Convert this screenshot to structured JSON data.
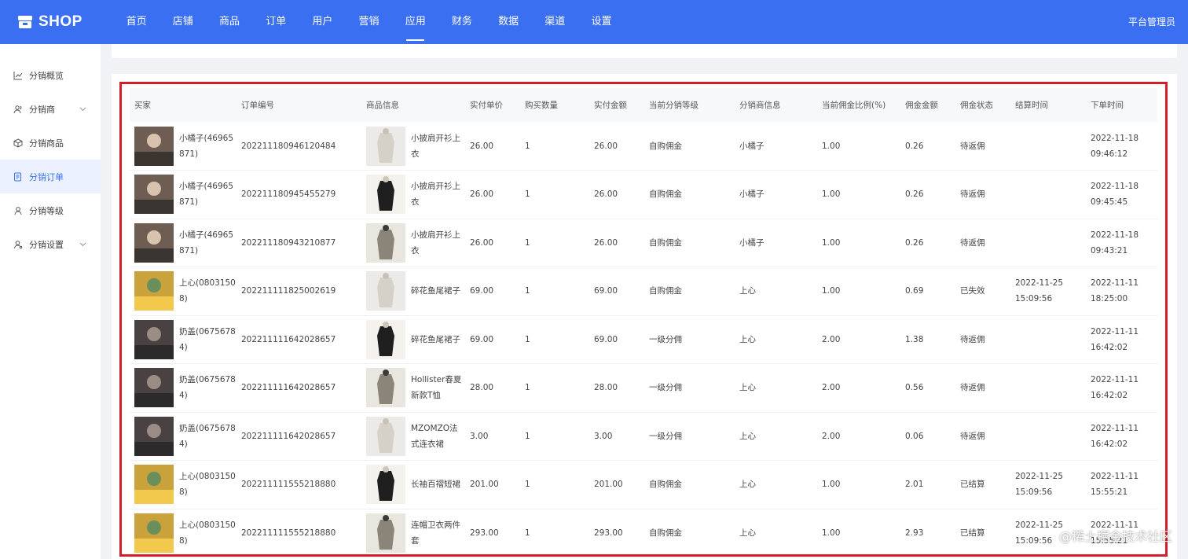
{
  "brand": {
    "name": "SHOP"
  },
  "nav": {
    "items": [
      "首页",
      "店铺",
      "商品",
      "订单",
      "用户",
      "营销",
      "应用",
      "财务",
      "数据",
      "渠道",
      "设置"
    ],
    "active": "应用"
  },
  "user": {
    "role": "平台管理员"
  },
  "sidebar": {
    "items": [
      {
        "label": "分销概览",
        "icon": "chart-line-icon"
      },
      {
        "label": "分销商",
        "icon": "users-icon",
        "expandable": true
      },
      {
        "label": "分销商品",
        "icon": "box-icon"
      },
      {
        "label": "分销订单",
        "icon": "order-icon",
        "active": true
      },
      {
        "label": "分销等级",
        "icon": "user-level-icon"
      },
      {
        "label": "分销设置",
        "icon": "user-settings-icon",
        "expandable": true
      }
    ]
  },
  "table": {
    "headers": [
      "买家",
      "订单编号",
      "商品信息",
      "实付单价",
      "购买数量",
      "实付金额",
      "当前分销等级",
      "分销商信息",
      "当前佣金比例(%)",
      "佣金金额",
      "佣金状态",
      "结算时间",
      "下单时间"
    ],
    "rows": [
      {
        "buyer": "小橘子(46965871)",
        "order_no": "202211180946120484",
        "goods": "小披肩开衫上衣",
        "unit_price": "26.00",
        "qty": "1",
        "amount": "26.00",
        "level": "自购佣金",
        "distributor": "小橘子",
        "ratio": "1.00",
        "commission": "0.26",
        "status": "待返佣",
        "settle_time": "",
        "order_time": "2022-11-18 09:46:12"
      },
      {
        "buyer": "小橘子(46965871)",
        "order_no": "202211180945455279",
        "goods": "小披肩开衫上衣",
        "unit_price": "26.00",
        "qty": "1",
        "amount": "26.00",
        "level": "自购佣金",
        "distributor": "小橘子",
        "ratio": "1.00",
        "commission": "0.26",
        "status": "待返佣",
        "settle_time": "",
        "order_time": "2022-11-18 09:45:45"
      },
      {
        "buyer": "小橘子(46965871)",
        "order_no": "202211180943210877",
        "goods": "小披肩开衫上衣",
        "unit_price": "26.00",
        "qty": "1",
        "amount": "26.00",
        "level": "自购佣金",
        "distributor": "小橘子",
        "ratio": "1.00",
        "commission": "0.26",
        "status": "待返佣",
        "settle_time": "",
        "order_time": "2022-11-18 09:43:21"
      },
      {
        "buyer": "上心(08031508)",
        "order_no": "202211111825002619",
        "goods": "碎花鱼尾裙子",
        "unit_price": "69.00",
        "qty": "1",
        "amount": "69.00",
        "level": "自购佣金",
        "distributor": "上心",
        "ratio": "1.00",
        "commission": "0.69",
        "status": "已失效",
        "settle_time": "2022-11-25 15:09:56",
        "order_time": "2022-11-11 18:25:00"
      },
      {
        "buyer": "奶盖(06756784)",
        "order_no": "202211111642028657",
        "goods": "碎花鱼尾裙子",
        "unit_price": "69.00",
        "qty": "1",
        "amount": "69.00",
        "level": "一级分佣",
        "distributor": "上心",
        "ratio": "2.00",
        "commission": "1.38",
        "status": "待返佣",
        "settle_time": "",
        "order_time": "2022-11-11 16:42:02"
      },
      {
        "buyer": "奶盖(06756784)",
        "order_no": "202211111642028657",
        "goods": "Hollister春夏新款T恤",
        "unit_price": "28.00",
        "qty": "1",
        "amount": "28.00",
        "level": "一级分佣",
        "distributor": "上心",
        "ratio": "2.00",
        "commission": "0.56",
        "status": "待返佣",
        "settle_time": "",
        "order_time": "2022-11-11 16:42:02"
      },
      {
        "buyer": "奶盖(06756784)",
        "order_no": "202211111642028657",
        "goods": "MZOMZO法式连衣裙",
        "unit_price": "3.00",
        "qty": "1",
        "amount": "3.00",
        "level": "一级分佣",
        "distributor": "上心",
        "ratio": "2.00",
        "commission": "0.06",
        "status": "待返佣",
        "settle_time": "",
        "order_time": "2022-11-11 16:42:02"
      },
      {
        "buyer": "上心(08031508)",
        "order_no": "202211111555218880",
        "goods": "长袖百褶短裙",
        "unit_price": "201.00",
        "qty": "1",
        "amount": "201.00",
        "level": "自购佣金",
        "distributor": "上心",
        "ratio": "1.00",
        "commission": "2.01",
        "status": "已结算",
        "settle_time": "2022-11-25 15:09:56",
        "order_time": "2022-11-11 15:55:21"
      },
      {
        "buyer": "上心(08031508)",
        "order_no": "202211111555218880",
        "goods": "连帽卫衣两件套",
        "unit_price": "293.00",
        "qty": "1",
        "amount": "293.00",
        "level": "自购佣金",
        "distributor": "上心",
        "ratio": "1.00",
        "commission": "2.93",
        "status": "已结算",
        "settle_time": "2022-11-25 15:09:56",
        "order_time": "2022-11-11 15:55:21"
      }
    ]
  },
  "watermark": "@稀土掘金技术社区",
  "colors": {
    "primary": "#3a6ff2",
    "highlight_border": "#d2202a",
    "sidebar_active_bg": "#ebf1ff"
  }
}
